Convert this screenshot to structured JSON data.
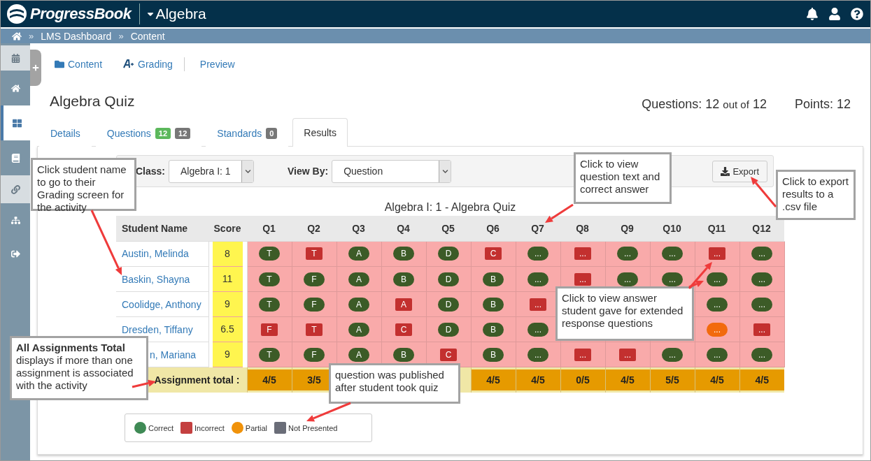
{
  "navbar": {
    "brand": "ProgressBook",
    "course": "Algebra"
  },
  "breadcrumb": [
    {
      "label": "»",
      "kind": "sep"
    },
    {
      "label": "LMS Dashboard",
      "kind": "link"
    },
    {
      "label": "»",
      "kind": "sep"
    },
    {
      "label": "Content",
      "kind": "link"
    }
  ],
  "sidebar": {
    "items": [
      {
        "selected": false
      },
      {
        "selected": false
      },
      {
        "selected": true
      },
      {
        "selected": false
      },
      {
        "selected": false
      },
      {
        "selected": false
      },
      {
        "selected": false
      }
    ]
  },
  "subnav": [
    {
      "label": "Content"
    },
    {
      "label": "Grading"
    },
    {
      "label": "Preview"
    }
  ],
  "title": "Algebra Quiz",
  "summary": {
    "questions_label": "Questions:",
    "questions_count": "12",
    "out_of": "out of",
    "questions_total": "12",
    "points_label": "Points:",
    "points": "12"
  },
  "tabs": [
    {
      "label": "Details",
      "selected": false
    },
    {
      "label": "Questions",
      "selected": false,
      "badges": [
        {
          "text": "12",
          "color": "#5cb85c"
        },
        {
          "text": "12",
          "color": "#777777"
        }
      ]
    },
    {
      "label": "Standards",
      "selected": false,
      "badges": [
        {
          "text": "0",
          "color": "#777777"
        }
      ]
    },
    {
      "label": "Results",
      "selected": true
    }
  ],
  "toolbar": {
    "class_label": "Class:",
    "class_value": "Algebra I: 1",
    "view_label": "View By:",
    "view_value": "Question",
    "export": "Export"
  },
  "table": {
    "title": "Algebra I: 1 - Algebra Quiz",
    "columns": [
      "Student Name",
      "Score"
    ],
    "question_columns": [
      "Q1",
      "Q2",
      "Q3",
      "Q4",
      "Q5",
      "Q6",
      "Q7",
      "Q8",
      "Q9",
      "Q10",
      "Q11",
      "Q12"
    ],
    "rows": [
      {
        "name": "Austin, Melinda",
        "score": "8",
        "cells": [
          {
            "answer": "T",
            "kind": "correct"
          },
          {
            "answer": "T",
            "kind": "incorrect"
          },
          {
            "answer": "A",
            "kind": "correct"
          },
          {
            "answer": "B",
            "kind": "correct"
          },
          {
            "answer": "D",
            "kind": "correct"
          },
          {
            "answer": "C",
            "kind": "incorrect"
          },
          {
            "answer": "...",
            "kind": "correct"
          },
          {
            "answer": "...",
            "kind": "incorrect"
          },
          {
            "answer": "...",
            "kind": "correct"
          },
          {
            "answer": "...",
            "kind": "correct"
          },
          {
            "answer": "...",
            "kind": "incorrect"
          },
          {
            "answer": "...",
            "kind": "correct"
          }
        ]
      },
      {
        "name": "Baskin, Shayna",
        "score": "11",
        "cells": [
          {
            "answer": "T",
            "kind": "correct"
          },
          {
            "answer": "F",
            "kind": "correct"
          },
          {
            "answer": "A",
            "kind": "correct"
          },
          {
            "answer": "B",
            "kind": "correct"
          },
          {
            "answer": "D",
            "kind": "correct"
          },
          {
            "answer": "B",
            "kind": "correct"
          },
          {
            "answer": "...",
            "kind": "correct"
          },
          {
            "answer": "...",
            "kind": "incorrect"
          },
          {
            "answer": "...",
            "kind": "correct"
          },
          {
            "answer": "...",
            "kind": "correct"
          },
          {
            "answer": "...",
            "kind": "correct"
          },
          {
            "answer": "...",
            "kind": "correct"
          }
        ]
      },
      {
        "name": "Coolidge, Anthony",
        "score": "9",
        "cells": [
          {
            "answer": "T",
            "kind": "correct"
          },
          {
            "answer": "F",
            "kind": "correct"
          },
          {
            "answer": "A",
            "kind": "correct"
          },
          {
            "answer": "A",
            "kind": "incorrect"
          },
          {
            "answer": "D",
            "kind": "correct"
          },
          {
            "answer": "B",
            "kind": "correct"
          },
          {
            "answer": "...",
            "kind": "incorrect"
          }
        ],
        "cells_end": [
          {
            "answer": "...",
            "kind": "correct"
          },
          {
            "answer": "...",
            "kind": "correct"
          }
        ]
      },
      {
        "name": "Dresden, Tiffany",
        "score": "6.5",
        "cells": [
          {
            "answer": "F",
            "kind": "incorrect"
          },
          {
            "answer": "T",
            "kind": "incorrect"
          },
          {
            "answer": "A",
            "kind": "correct"
          },
          {
            "answer": "C",
            "kind": "incorrect"
          },
          {
            "answer": "D",
            "kind": "correct"
          },
          {
            "answer": "B",
            "kind": "correct"
          },
          {
            "answer": "...",
            "kind": "correct"
          }
        ],
        "cells_end": [
          {
            "answer": "...",
            "kind": "partial"
          },
          {
            "answer": "...",
            "kind": "incorrect"
          }
        ]
      },
      {
        "name": "n, Mariana",
        "score": "9",
        "partly_covered": true,
        "cells": [
          {
            "answer": "T",
            "kind": "correct"
          },
          {
            "answer": "F",
            "kind": "correct"
          },
          {
            "answer": "A",
            "kind": "correct"
          },
          {
            "answer": "B",
            "kind": "correct"
          },
          {
            "answer": "C",
            "kind": "incorrect"
          },
          {
            "answer": "B",
            "kind": "correct"
          },
          {
            "answer": "...",
            "kind": "correct"
          },
          {
            "answer": "...",
            "kind": "incorrect"
          },
          {
            "answer": "...",
            "kind": "incorrect"
          },
          {
            "answer": "...",
            "kind": "correct"
          },
          {
            "answer": "...",
            "kind": "correct"
          },
          {
            "answer": "...",
            "kind": "correct"
          }
        ]
      }
    ],
    "total_label": "Assignment total :",
    "totals": [
      "4/5",
      "3/5"
    ],
    "totals_end": [
      "4/5",
      "4/5",
      "0/5",
      "4/5",
      "5/5",
      "4/5",
      "4/5"
    ]
  },
  "legend": [
    {
      "label": "Correct",
      "kind": "correct"
    },
    {
      "label": "Incorrect",
      "kind": "incorrect"
    },
    {
      "label": "Partial",
      "kind": "partial"
    },
    {
      "label": "Not Presented",
      "kind": "not_presented"
    }
  ],
  "callouts": [
    {
      "text": "Click student name to go to their Grading screen for the activity",
      "kind": "student"
    },
    {
      "text": "Click to view question text and correct answer",
      "kind": "question"
    },
    {
      "text": "Click to export results to a .csv file",
      "kind": "export"
    },
    {
      "text": "Click to view answer student gave for extended response questions",
      "kind": "extended"
    },
    {
      "text": "**All Assignments Total** displays if more than one assignment is associated with the activity",
      "kind": "total"
    },
    {
      "text": "question was published after student took quiz",
      "kind": "published"
    }
  ]
}
